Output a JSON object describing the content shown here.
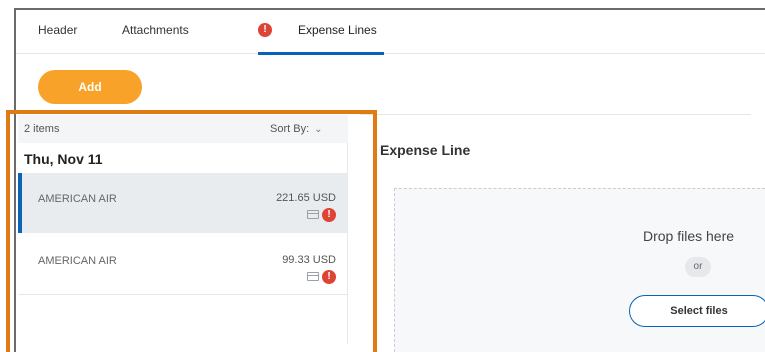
{
  "tabs": [
    {
      "label": "Header"
    },
    {
      "label": "Attachments"
    },
    {
      "label": "Expense Lines",
      "active": true,
      "has_error": true
    }
  ],
  "toolbar": {
    "add_label": "Add"
  },
  "list": {
    "items_count": "2 items",
    "sort_label": "Sort By:",
    "date_group": "Thu, Nov 11",
    "rows": [
      {
        "merchant": "AMERICAN AIR",
        "amount": "221.65 USD",
        "selected": true
      },
      {
        "merchant": "AMERICAN AIR",
        "amount": "99.33 USD",
        "selected": false
      }
    ]
  },
  "detail": {
    "title": "Expense Line",
    "drop_text": "Drop files here",
    "or_text": "or",
    "select_files_label": "Select files"
  },
  "colors": {
    "accent_blue": "#0b62b9",
    "add_button": "#f8a22a",
    "highlight_box": "#e07a12",
    "error_red": "#de4436"
  },
  "icons": {
    "error": "exclamation-circle-icon",
    "receipt": "credit-card-icon",
    "sort": "chevron-down-icon"
  }
}
